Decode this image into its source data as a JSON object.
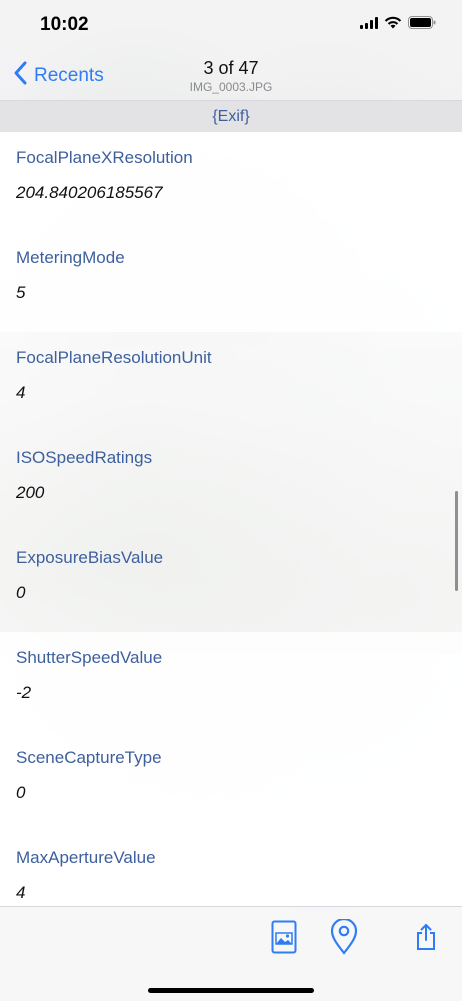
{
  "status": {
    "time": "10:02"
  },
  "nav": {
    "back_label": "Recents",
    "title": "3 of 47",
    "subtitle": "IMG_0003.JPG"
  },
  "section": {
    "title": "{Exif}"
  },
  "rows": [
    {
      "key": "FocalPlaneXResolution",
      "value": "204.840206185567"
    },
    {
      "key": "MeteringMode",
      "value": "5"
    },
    {
      "key": "FocalPlaneResolutionUnit",
      "value": "4"
    },
    {
      "key": "ISOSpeedRatings",
      "value": "200"
    },
    {
      "key": "ExposureBiasValue",
      "value": "0"
    },
    {
      "key": "ShutterSpeedValue",
      "value": "-2"
    },
    {
      "key": "SceneCaptureType",
      "value": "0"
    },
    {
      "key": "MaxApertureValue",
      "value": "4"
    }
  ],
  "toolbar": {
    "icons": [
      "photo-icon",
      "location-pin-icon",
      "share-icon"
    ]
  },
  "colors": {
    "accent": "#2f7cf6",
    "key_text": "#3d5f9e",
    "section_bg": "#e3e3e6"
  }
}
